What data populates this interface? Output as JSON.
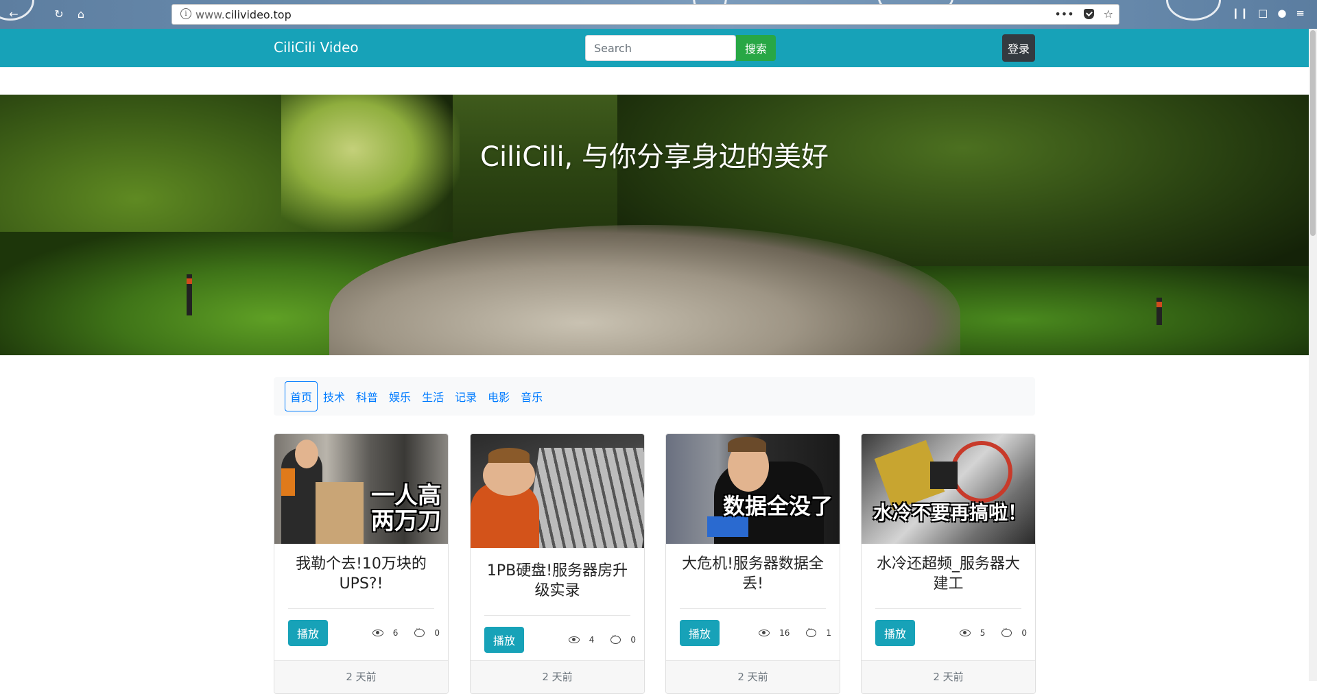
{
  "browser": {
    "url_prefix": "www.",
    "url_domain": "cilivideo.top",
    "info_icon": "i"
  },
  "navbar": {
    "brand": "CiliCili Video",
    "search_placeholder": "Search",
    "search_button": "搜索",
    "login_button": "登录",
    "color": "#17a2b8"
  },
  "hero": {
    "title": "CiliCili, 与你分享身边的美好"
  },
  "tabs": [
    "首页",
    "技术",
    "科普",
    "娱乐",
    "生活",
    "记录",
    "电影",
    "音乐"
  ],
  "cards": [
    {
      "thumb_caption_line1": "一人高",
      "thumb_caption_line2": "两万刀",
      "title": "我勒个去!10万块的UPS?!",
      "play": "播放",
      "views": "6",
      "comments": "0",
      "time": "2 天前"
    },
    {
      "thumb_caption_line1": "",
      "thumb_caption_line2": "",
      "title": "1PB硬盘!服务器房升级实录",
      "play": "播放",
      "views": "4",
      "comments": "0",
      "time": "2 天前"
    },
    {
      "thumb_caption_line1": "数据全没了",
      "thumb_caption_line2": "",
      "title": "大危机!服务器数据全丢!",
      "play": "播放",
      "views": "16",
      "comments": "1",
      "time": "2 天前"
    },
    {
      "thumb_caption_line1": "水冷不要再搞啦！",
      "thumb_caption_line2": "",
      "title": "水冷还超频_服务器大建工",
      "play": "播放",
      "views": "5",
      "comments": "0",
      "time": "2 天前"
    }
  ],
  "colors": {
    "primary": "#17a2b8",
    "success": "#28a745",
    "dark": "#343a40",
    "link": "#007bff"
  }
}
